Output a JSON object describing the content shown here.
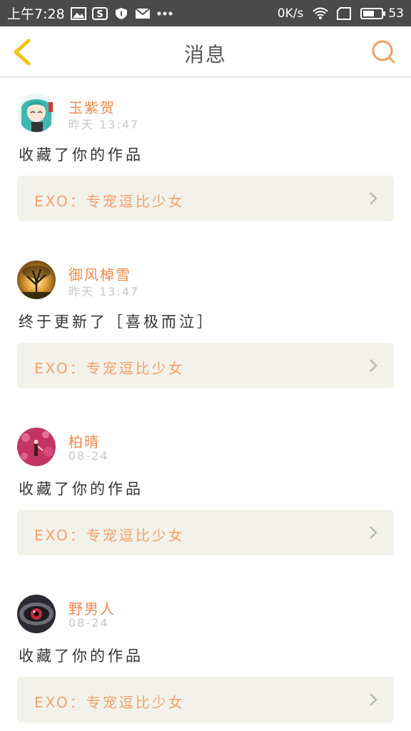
{
  "status_bar": {
    "time": "上午7:28",
    "network_speed": "0K/s",
    "battery": "53",
    "icons": [
      "image-icon",
      "s-app-icon",
      "shield-icon",
      "mail-icon",
      "more-dots-icon",
      "wifi-icon",
      "sim-icon",
      "battery-icon"
    ]
  },
  "header": {
    "title": "消息",
    "back_icon": "chevron-left-icon",
    "search_icon": "search-icon",
    "accent": "#f0c419"
  },
  "notifications": [
    {
      "user": "玉紫贺",
      "time": "昨天 13:47",
      "message": "收藏了你的作品",
      "work": "EXO：专宠逗比少女",
      "avatar": "anime-girl-avatar"
    },
    {
      "user": "御风棹雪",
      "time": "昨天 13:47",
      "message": "终于更新了［喜极而泣］",
      "work": "EXO：专宠逗比少女",
      "avatar": "sunset-tree-avatar"
    },
    {
      "user": "柏晴",
      "time": "08-24",
      "message": "收藏了你的作品",
      "work": "EXO：专宠逗比少女",
      "avatar": "pink-bokeh-avatar"
    },
    {
      "user": "野男人",
      "time": "08-24",
      "message": "收藏了你的作品",
      "work": "EXO：专宠逗比少女",
      "avatar": "dark-eye-avatar"
    }
  ],
  "colors": {
    "username": "#f08a4b",
    "work_title": "#f2a06a",
    "work_bg": "#f2f2ea"
  }
}
